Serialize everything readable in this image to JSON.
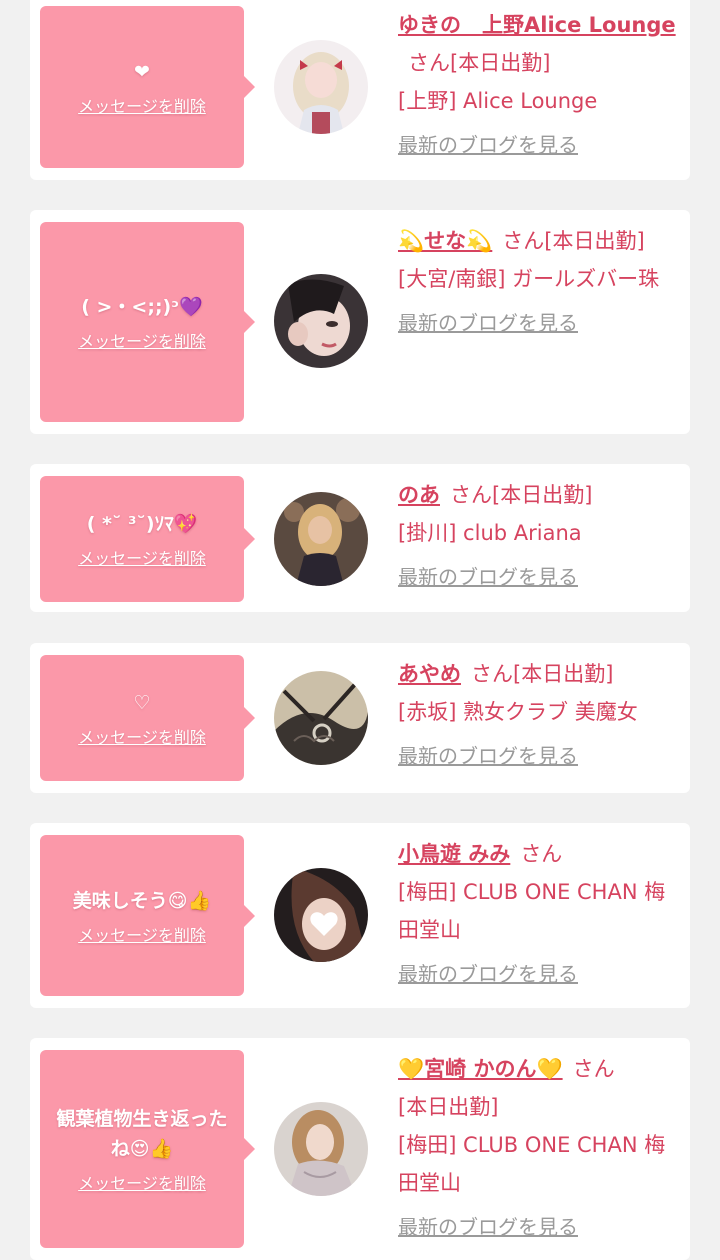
{
  "delete_label": "メッセージを削除",
  "blog_label": "最新のブログを見る",
  "san_suffix": "さん",
  "cards": [
    {
      "message": "❤",
      "name": "ゆきの　上野Alice Lounge",
      "status": "[本日出勤]",
      "shop": "[上野] Alice Lounge",
      "avatar_icon": "avatar-blonde-pink"
    },
    {
      "message": "( >・<;;)ᵓ💜",
      "name": "💫せな💫",
      "status": "[本日出勤]",
      "shop": "[大宮/南銀] ガールズバー珠",
      "avatar_icon": "avatar-dark-hair"
    },
    {
      "message": "( *˘ ³˘)ｿﾏ💖",
      "name": "のあ",
      "status": "[本日出勤]",
      "shop": "[掛川] club Ariana",
      "avatar_icon": "avatar-blonde-dress"
    },
    {
      "message": "♡",
      "name": "あやめ",
      "status": "[本日出勤]",
      "shop": "[赤坂] 熟女クラブ 美魔女",
      "avatar_icon": "avatar-lace"
    },
    {
      "message": "美味しそう😋👍",
      "name": "小鳥遊 みみ",
      "status": "",
      "shop": "[梅田] CLUB ONE CHAN 梅田堂山",
      "avatar_icon": "avatar-heart-face"
    },
    {
      "message": "観葉植物生き返ったね😍👍",
      "name": "💛宮崎 かのん💛",
      "status": "[本日出勤]",
      "shop": "[梅田] CLUB ONE CHAN 梅田堂山",
      "avatar_icon": "avatar-light-hair"
    }
  ],
  "colors": {
    "background": "#f1f1f1",
    "bubble": "#fb98a9",
    "accent_text": "#d6435f",
    "link_gray": "#9a9a9a"
  }
}
